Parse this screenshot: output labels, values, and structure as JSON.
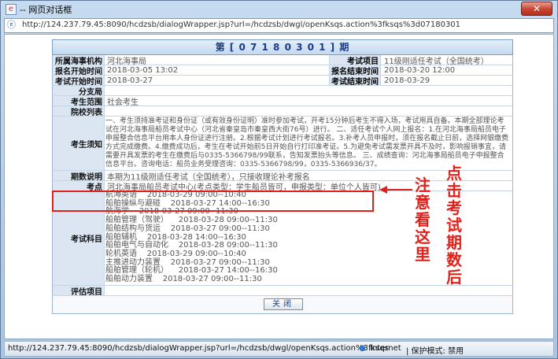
{
  "window": {
    "title": "-- 网页对话框",
    "title_icon": "e",
    "close_symbol": "✕"
  },
  "address": {
    "url": "http://124.237.79.45:8090/hcdzsb/dialogWrapper.jsp?url=/hcdzsb/dwgl/openKsqs.action%3fksqs%3d07180301"
  },
  "form": {
    "header": "第 [ 0 7 1 8 0 3 0 1 ] 期",
    "rows": {
      "org_label": "所属海事机构",
      "org_value": "河北海事局",
      "item_label": "考试项目",
      "item_value": "11级刚适任考试（全国统考）",
      "signup_start_label": "报名开始时间",
      "signup_start_value": "2018-03-05 13:02",
      "signup_end_label": "报名结束时间",
      "signup_end_value": "2018-03-20 12:00",
      "exam_start_label": "考试开始时间",
      "exam_start_value": "2018-03-27",
      "exam_end_label": "考试结束时间",
      "exam_end_value": "2018-03-29",
      "branch_label": "分支局",
      "branch_value": "",
      "scope_label": "考生范围",
      "scope_value": "社会考生",
      "school_label": "院校列表",
      "school_value": "",
      "notice_label": "考生须知",
      "notice_value": "一、考生须持准考证和身份证（或有效身份证明）准时参加考试，开考15分钟后考生不得入场，考试用具自备。本期全部理论考试在河北海事局船员考试中心（河北省秦皇岛市秦皇西大街76号）进行。 二、适任考试个人网上报名：1.在河北海事局船员电子申报整合信息平台用本人身份证进行注册。2.根据考试计划进行考试报名。3.补考人员申报时，须在报名截止日前，选择网银缴费方式完成缴费。4.缴费成功后，考生在考试开始前5日开始自行打印准考证。5.为避免考试需发票开具不及时，影响报销事宜，请需要开具发票的考生在缴费后与0335-5366798/99联系，告知发票抬头等信息。 三、成绩查询：河北海事局船员电子申报整合信息平台。咨询电话：船员业务受理咨询：0335-5366798/99，0335-5366936/37。",
      "period_label": "期数说明",
      "period_value": "本期为11级刚适任考试（全国统考），只接收理论补考报名",
      "site_label": "考点",
      "site_value": "河北海事局船员考试中心(考点类型：学生船员皆可，申报类型：单位个人皆可)",
      "subjects_label": "考试科目",
      "subjects": [
        "航海英语    2018-03-29 09:00--10:40",
        "船舶操纵与避碰    2018-03-27 14:00--16:30",
        "航海学    2018-03-27 09:00--11:30",
        "船舶管理（驾驶）    2018-03-28 09:00--11:30",
        "船舶结构与货运    2018-03-27 09:00--11:30",
        "船舶辅机    2018-03-28 14:00--16:30",
        "船舶电气与自动化    2018-03-28 09:00--11:30",
        "轮机英语    2018-03-29 09:00--10:40",
        "主推进动力装置    2018-03-27 09:00--11:30",
        "船舶管理（轮机）    2018-03-27 14:00--16:30",
        "船舶动力装置    2018-03-27 09:00--11:30"
      ],
      "eval_label": "评估项目",
      "eval_value": ""
    },
    "close_button": "关闭"
  },
  "annotations": {
    "left_text": "注意看这里",
    "right_text": "点击考试期数后",
    "color": "#e0201a"
  },
  "status": {
    "url": "http://124.237.79.45:8090/hcdzsb/dialogWrapper.jsp?url=/hcdzsb/dwgl/openKsqs.action%3fksqs",
    "zone": "Internet",
    "mode": "| 保护模式: 禁用"
  }
}
